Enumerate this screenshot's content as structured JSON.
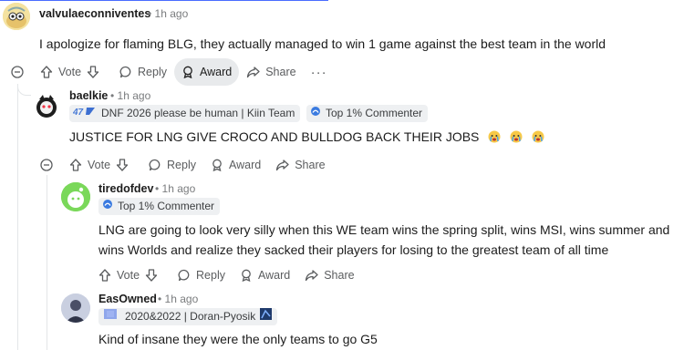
{
  "comments": [
    {
      "username": "valvulaeconniventes",
      "time": "1h ago",
      "body": "I apologize for flaming BLG, they actually managed to win 1 game against the best team in the world",
      "actions": {
        "vote": "Vote",
        "reply": "Reply",
        "award": "Award",
        "share": "Share",
        "more": "···"
      }
    },
    {
      "username": "baelkie",
      "time": "1h ago",
      "flair": "DNF 2026 please be human | Kiin Team",
      "flair2": "Top 1% Commenter",
      "body": "JUSTICE FOR LNG GIVE CROCO AND BULLDOG BACK THEIR JOBS",
      "actions": {
        "vote": "Vote",
        "reply": "Reply",
        "award": "Award",
        "share": "Share"
      }
    },
    {
      "username": "tiredofdev",
      "time": "1h ago",
      "flair2": "Top 1% Commenter",
      "body_line1": "LNG are going to look very silly when this WE team wins the spring split, wins MSI, wins summer and",
      "body_line2": "wins Worlds and realize they sacked their players for losing to the greatest team of all time",
      "actions": {
        "vote": "Vote",
        "reply": "Reply",
        "award": "Award",
        "share": "Share"
      }
    },
    {
      "username": "EasOwned",
      "time": "1h ago",
      "flair": "2020&2022 | Doran-Pyosik",
      "body": "Kind of insane they were the only teams to go G5"
    }
  ],
  "separator": "•",
  "colors": {
    "accent": "#4a6cff",
    "active_bg": "#e8eaec",
    "flair_bg": "#eef0f2"
  }
}
